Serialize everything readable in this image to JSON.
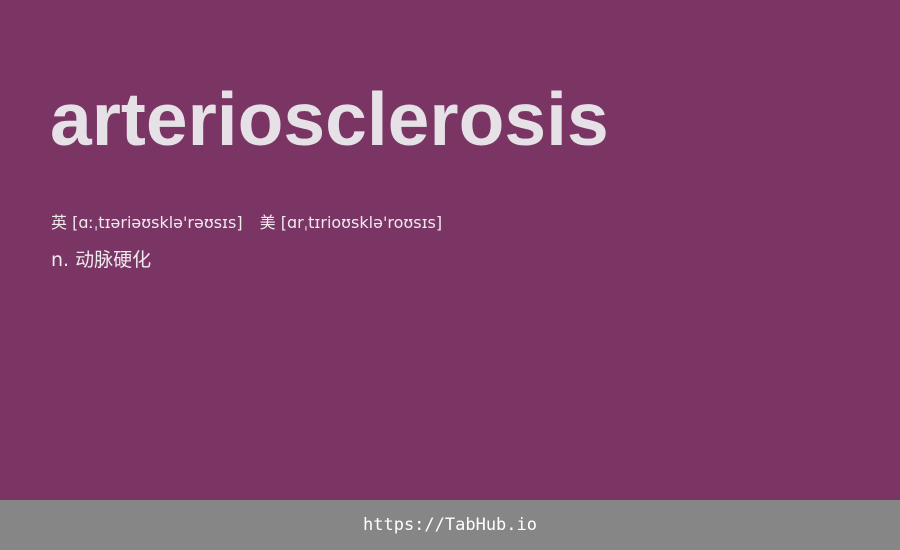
{
  "entry": {
    "word": "arteriosclerosis",
    "uk_label": "英",
    "uk_ipa": "[ɑːˌtɪəriəʊsklə'rəʊsɪs]",
    "us_label": "美",
    "us_ipa": "[ɑrˌtɪrioʊsklə'roʊsɪs]",
    "definition": "n. 动脉硬化"
  },
  "footer": {
    "link_text": "https://TabHub.io"
  },
  "colors": {
    "background": "#7b3564",
    "footer_background": "#868686",
    "text": "#e6e1e6"
  }
}
